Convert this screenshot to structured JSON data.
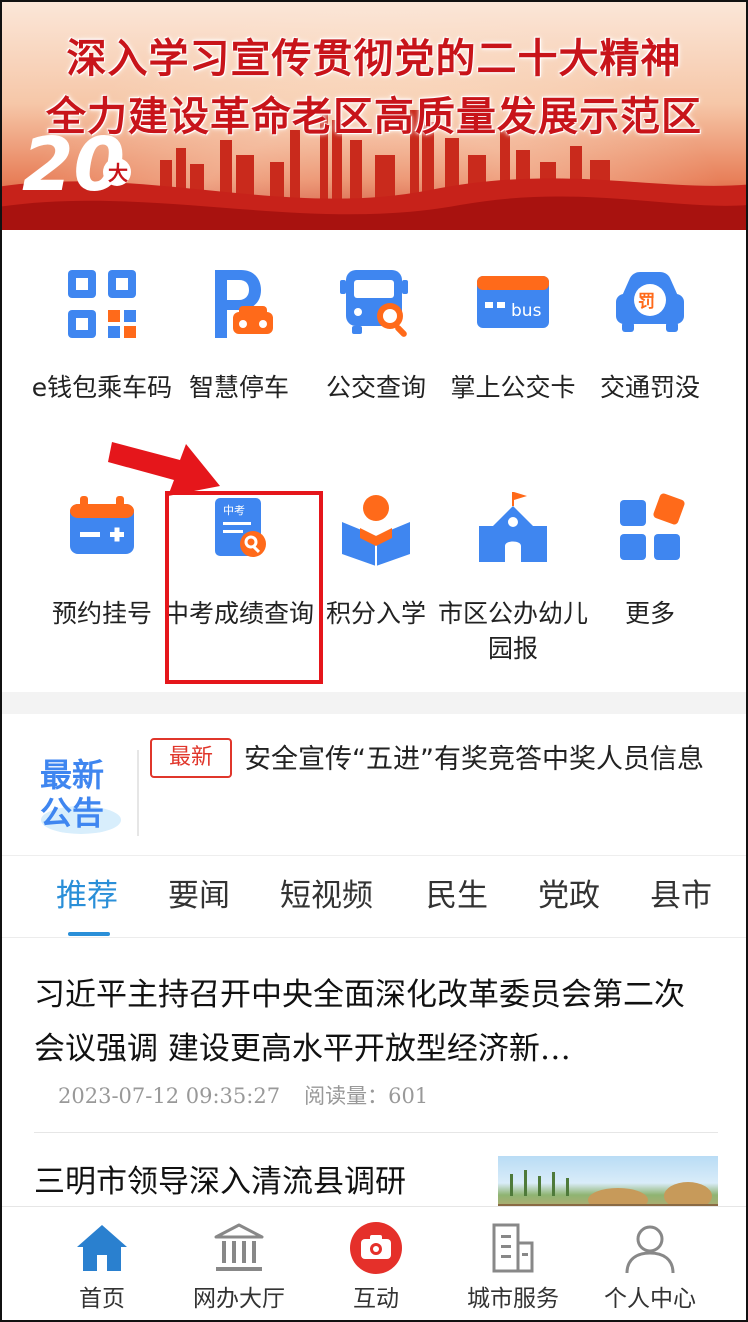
{
  "banner": {
    "line1": "深入学习宣传贯彻党的二十大精神",
    "line2": "全力建设革命老区高质量发展示范区"
  },
  "services": {
    "row1": [
      {
        "label": "e钱包乘车码",
        "icon": "qr-code-icon"
      },
      {
        "label": "智慧停车",
        "icon": "parking-car-icon"
      },
      {
        "label": "公交查询",
        "icon": "bus-search-icon"
      },
      {
        "label": "掌上公交卡",
        "icon": "bus-card-icon",
        "badge": "bus"
      },
      {
        "label": "交通罚没",
        "icon": "traffic-fine-icon",
        "badge": "罚"
      }
    ],
    "row2": [
      {
        "label": "预约挂号",
        "icon": "battery-calendar-icon"
      },
      {
        "label": "中考成绩查询",
        "icon": "exam-score-icon",
        "badge": "中考"
      },
      {
        "label": "积分入学",
        "icon": "reading-student-icon"
      },
      {
        "label": "市区公办幼儿园报",
        "icon": "school-flag-icon"
      },
      {
        "label": "更多",
        "icon": "more-grid-icon"
      }
    ]
  },
  "notice": {
    "logo_line1": "最新",
    "logo_line2": "公告",
    "tag": "最新",
    "text": "安全宣传“五进”有奖竞答中奖人员信息"
  },
  "tabs": [
    {
      "label": "推荐",
      "active": true
    },
    {
      "label": "要闻"
    },
    {
      "label": "短视频"
    },
    {
      "label": "民生"
    },
    {
      "label": "党政"
    },
    {
      "label": "县市"
    }
  ],
  "news": [
    {
      "title": "习近平主持召开中央全面深化改革委员会第二次会议强调 建设更高水平开放型经济新…",
      "date": "2023-07-12 09:35:27",
      "reads": "阅读量：601"
    },
    {
      "title": "三明市领导深入清流县调研"
    }
  ],
  "bottom_nav": [
    {
      "label": "首页",
      "icon": "home-icon"
    },
    {
      "label": "网办大厅",
      "icon": "government-hall-icon"
    },
    {
      "label": "互动",
      "icon": "camera-icon"
    },
    {
      "label": "城市服务",
      "icon": "city-building-icon"
    },
    {
      "label": "个人中心",
      "icon": "user-icon"
    }
  ],
  "colors": {
    "primary_blue": "#3f86f0",
    "accent_orange": "#ff6a1a",
    "highlight_red": "#e5161b",
    "tab_active": "#2a8fd8"
  }
}
